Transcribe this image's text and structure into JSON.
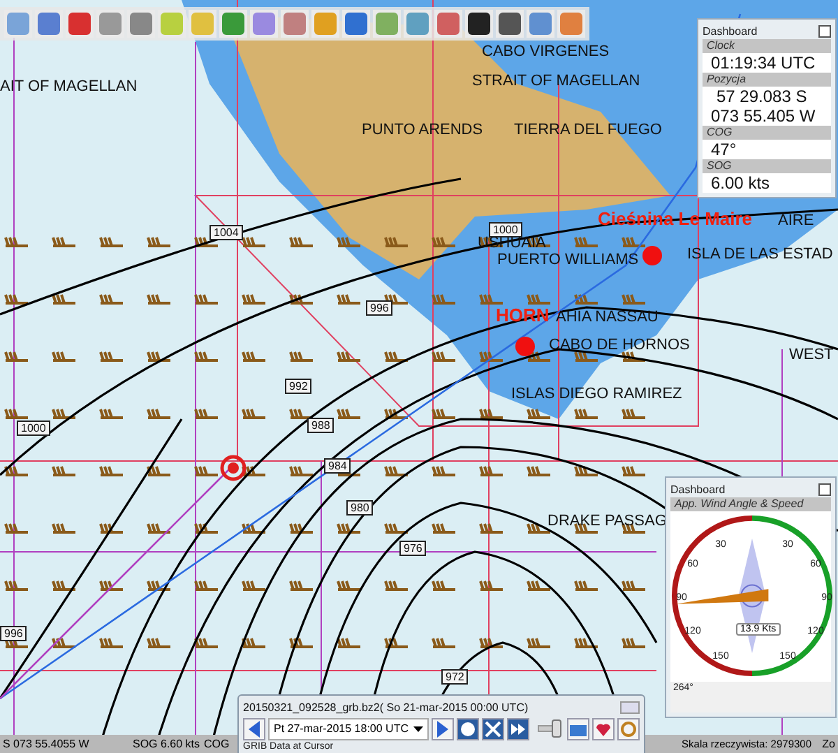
{
  "map": {
    "labels": [
      {
        "text": "CABO VIRGENES",
        "kind": "place"
      },
      {
        "text": "AIT OF MAGELLAN",
        "kind": "place"
      },
      {
        "text": "STRAIT OF MAGELLAN",
        "kind": "place"
      },
      {
        "text": "PUNTO ARENDS",
        "kind": "place"
      },
      {
        "text": "TIERRA DEL FUEGO",
        "kind": "place"
      },
      {
        "text": "Cieśnina Le Maire",
        "kind": "highlight"
      },
      {
        "text": "AIRE",
        "kind": "place"
      },
      {
        "text": "USHUAIA",
        "kind": "place"
      },
      {
        "text": "PUERTO WILLIAMS",
        "kind": "place"
      },
      {
        "text": "ISLA DE LAS ESTAD",
        "kind": "place"
      },
      {
        "text": "HORN",
        "kind": "highlight"
      },
      {
        "text": "AHIA NASSAU",
        "kind": "place"
      },
      {
        "text": "CABO DE HORNOS",
        "kind": "place"
      },
      {
        "text": "WEST",
        "kind": "place"
      },
      {
        "text": "ISLAS DIEGO RAMIREZ",
        "kind": "place"
      },
      {
        "text": "DRAKE PASSAG",
        "kind": "place"
      }
    ],
    "isobars": [
      "1004",
      "1000",
      "996",
      "992",
      "988",
      "984",
      "980",
      "976",
      "972",
      "1000",
      "996"
    ]
  },
  "position_dashboard": {
    "title": "Dashboard",
    "fields": [
      {
        "label": "Clock",
        "lines": [
          "01:19:34 UTC"
        ]
      },
      {
        "label": "Pozycja",
        "lines": [
          "57 29.083 S",
          "073 55.405 W"
        ]
      },
      {
        "label": "COG",
        "lines": [
          "47°"
        ]
      },
      {
        "label": "SOG",
        "lines": [
          "6.00 kts"
        ]
      }
    ]
  },
  "wind_dashboard": {
    "title": "Dashboard",
    "instrument": "App. Wind Angle & Speed",
    "scale_labels": [
      "30",
      "30",
      "60",
      "60",
      "90",
      "90",
      "120",
      "120",
      "150",
      "150"
    ],
    "speed": "13.9 Kts",
    "angle": "264°"
  },
  "grib": {
    "file": "20150321_092528_grb.bz2( So 21-mar-2015 00:00  UTC)",
    "time": "Pt 27-mar-2015 18:00  UTC",
    "slider": {
      "level": 0.93
    },
    "section": "GRIB Data at Cursor"
  },
  "status_bar": [
    "S   073 55.4055 W",
    "SOG 6.60 kts",
    "COG",
    "Skala rzeczywista:  2979300",
    "Zo"
  ]
}
